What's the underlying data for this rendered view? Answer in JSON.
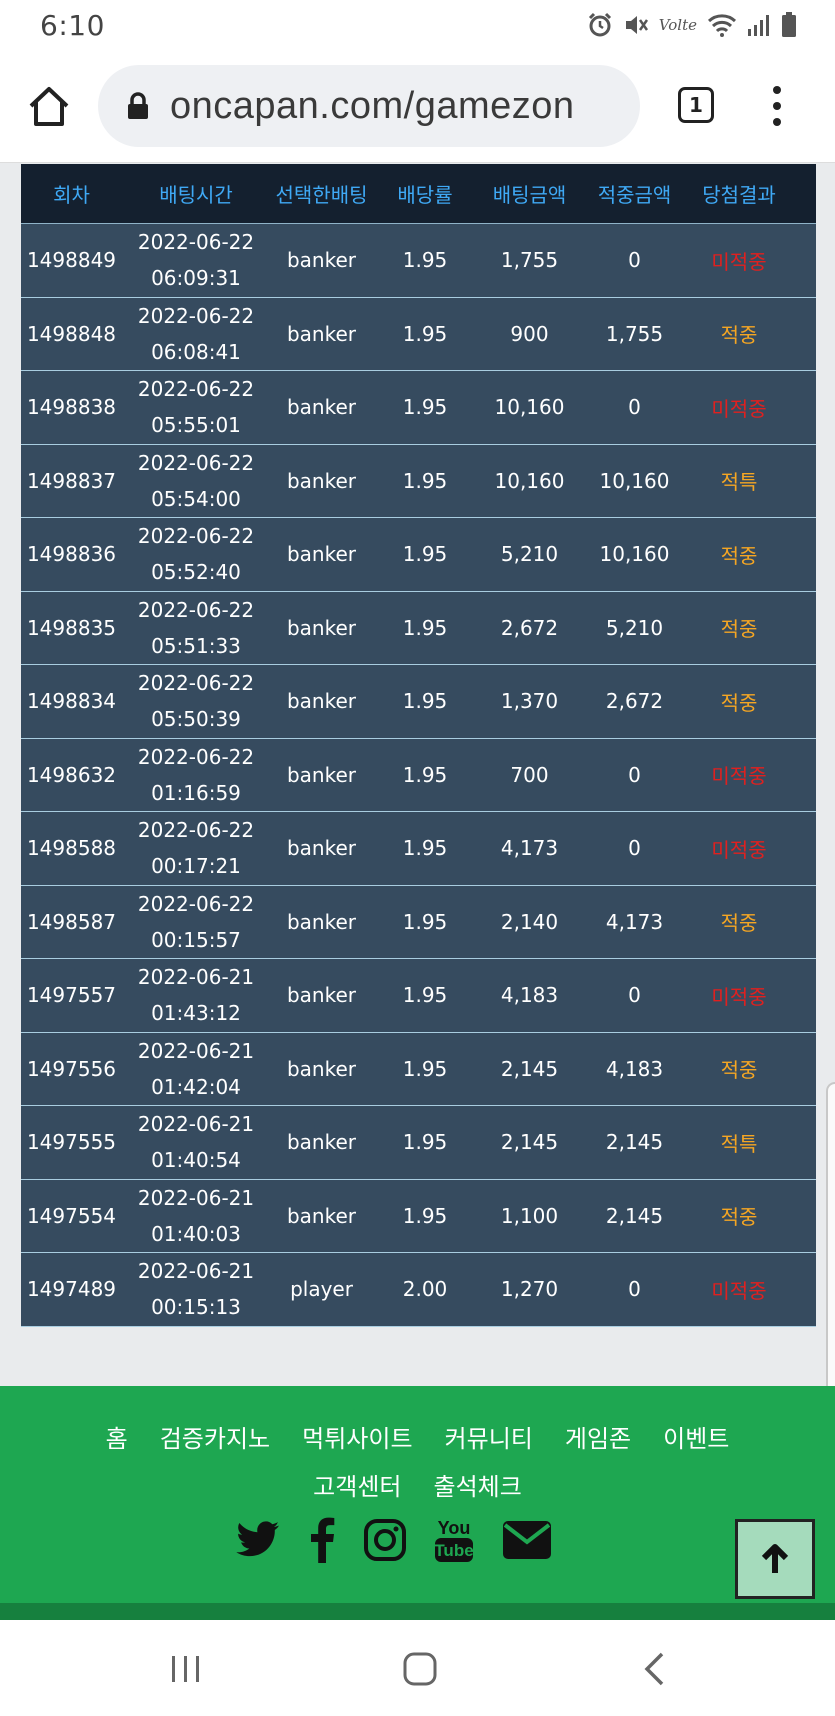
{
  "status_bar": {
    "time": "6:10",
    "network_label": "Volte"
  },
  "browser": {
    "url": "oncapan.com/gamezon",
    "tab_count": "1"
  },
  "table": {
    "headers": [
      "회차",
      "배팅시간",
      "선택한배팅",
      "배당률",
      "배팅금액",
      "적중금액",
      "당첨결과"
    ],
    "rows": [
      {
        "round": "1498849",
        "date": "2022-06-22",
        "time": "06:09:31",
        "pick": "banker",
        "odds": "1.95",
        "bet": "1,755",
        "win": "0",
        "result": "미적중",
        "result_type": "lose"
      },
      {
        "round": "1498848",
        "date": "2022-06-22",
        "time": "06:08:41",
        "pick": "banker",
        "odds": "1.95",
        "bet": "900",
        "win": "1,755",
        "result": "적중",
        "result_type": "win"
      },
      {
        "round": "1498838",
        "date": "2022-06-22",
        "time": "05:55:01",
        "pick": "banker",
        "odds": "1.95",
        "bet": "10,160",
        "win": "0",
        "result": "미적중",
        "result_type": "lose"
      },
      {
        "round": "1498837",
        "date": "2022-06-22",
        "time": "05:54:00",
        "pick": "banker",
        "odds": "1.95",
        "bet": "10,160",
        "win": "10,160",
        "result": "적특",
        "result_type": "win"
      },
      {
        "round": "1498836",
        "date": "2022-06-22",
        "time": "05:52:40",
        "pick": "banker",
        "odds": "1.95",
        "bet": "5,210",
        "win": "10,160",
        "result": "적중",
        "result_type": "win"
      },
      {
        "round": "1498835",
        "date": "2022-06-22",
        "time": "05:51:33",
        "pick": "banker",
        "odds": "1.95",
        "bet": "2,672",
        "win": "5,210",
        "result": "적중",
        "result_type": "win"
      },
      {
        "round": "1498834",
        "date": "2022-06-22",
        "time": "05:50:39",
        "pick": "banker",
        "odds": "1.95",
        "bet": "1,370",
        "win": "2,672",
        "result": "적중",
        "result_type": "win"
      },
      {
        "round": "1498632",
        "date": "2022-06-22",
        "time": "01:16:59",
        "pick": "banker",
        "odds": "1.95",
        "bet": "700",
        "win": "0",
        "result": "미적중",
        "result_type": "lose"
      },
      {
        "round": "1498588",
        "date": "2022-06-22",
        "time": "00:17:21",
        "pick": "banker",
        "odds": "1.95",
        "bet": "4,173",
        "win": "0",
        "result": "미적중",
        "result_type": "lose"
      },
      {
        "round": "1498587",
        "date": "2022-06-22",
        "time": "00:15:57",
        "pick": "banker",
        "odds": "1.95",
        "bet": "2,140",
        "win": "4,173",
        "result": "적중",
        "result_type": "win"
      },
      {
        "round": "1497557",
        "date": "2022-06-21",
        "time": "01:43:12",
        "pick": "banker",
        "odds": "1.95",
        "bet": "4,183",
        "win": "0",
        "result": "미적중",
        "result_type": "lose"
      },
      {
        "round": "1497556",
        "date": "2022-06-21",
        "time": "01:42:04",
        "pick": "banker",
        "odds": "1.95",
        "bet": "2,145",
        "win": "4,183",
        "result": "적중",
        "result_type": "win"
      },
      {
        "round": "1497555",
        "date": "2022-06-21",
        "time": "01:40:54",
        "pick": "banker",
        "odds": "1.95",
        "bet": "2,145",
        "win": "2,145",
        "result": "적특",
        "result_type": "win"
      },
      {
        "round": "1497554",
        "date": "2022-06-21",
        "time": "01:40:03",
        "pick": "banker",
        "odds": "1.95",
        "bet": "1,100",
        "win": "2,145",
        "result": "적중",
        "result_type": "win"
      },
      {
        "round": "1497489",
        "date": "2022-06-21",
        "time": "00:15:13",
        "pick": "player",
        "odds": "2.00",
        "bet": "1,270",
        "win": "0",
        "result": "미적중",
        "result_type": "lose"
      }
    ]
  },
  "footer": {
    "nav_row1": [
      "홈",
      "검증카지노",
      "먹튀사이트",
      "커뮤니티",
      "게임존",
      "이벤트"
    ],
    "nav_row2": [
      "고객센터",
      "출석체크"
    ],
    "social_icons": [
      "twitter-icon",
      "facebook-icon",
      "instagram-icon",
      "youtube-icon",
      "email-icon"
    ],
    "youtube_text": [
      "You",
      "Tube"
    ]
  },
  "colors": {
    "header_bg": "#14202f",
    "header_text": "#3fa9f5",
    "row_bg": "#364b5f",
    "win": "#f5a623",
    "lose": "#e0201f",
    "footer_bg": "#1ea751"
  }
}
